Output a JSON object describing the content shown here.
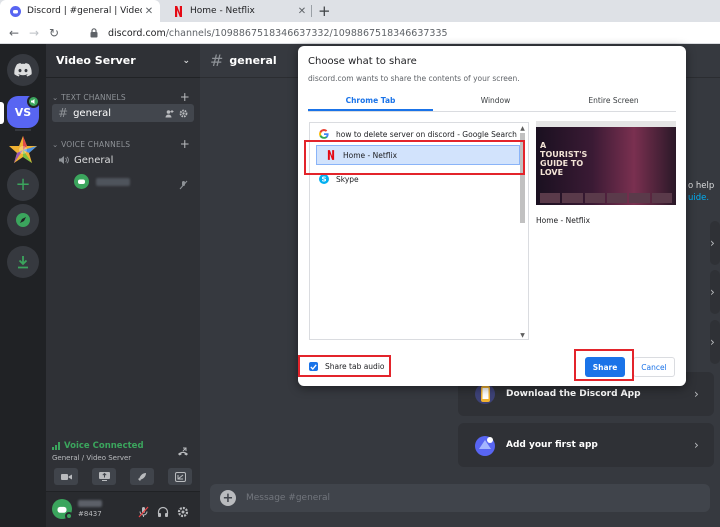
{
  "browser": {
    "tabs": [
      {
        "title": "Discord | #general | Video Server",
        "active": true
      },
      {
        "title": "Home - Netflix",
        "active": false
      }
    ],
    "new_tab": "+",
    "url_host": "discord.com",
    "url_path": "/channels/1098867518346637332/1098867518346637335"
  },
  "guilds": {
    "vs_label": "VS"
  },
  "server": {
    "name": "Video Server",
    "text_category": "TEXT CHANNELS",
    "voice_category": "VOICE CHANNELS",
    "text_channel": "general",
    "voice_channel": "General"
  },
  "voice_status": {
    "title": "Voice Connected",
    "subtitle": "General / Video Server"
  },
  "user": {
    "tag": "#8437"
  },
  "chat": {
    "channel": "general",
    "help_text": "o help",
    "help_link": "uide.",
    "cards": [
      {
        "label": "Download the Discord App"
      },
      {
        "label": "Add your first app"
      }
    ],
    "message_placeholder": "Message #general"
  },
  "share_dialog": {
    "title": "Choose what to share",
    "subtitle": "discord.com wants to share the contents of your screen.",
    "tabs": [
      "Chrome Tab",
      "Window",
      "Entire Screen"
    ],
    "active_tab": "Chrome Tab",
    "sources": [
      {
        "title": "how to delete server on discord - Google Search",
        "icon": "google-icon"
      },
      {
        "title": "Home - Netflix",
        "icon": "netflix-icon",
        "selected": true
      },
      {
        "title": "Skype",
        "icon": "skype-icon"
      }
    ],
    "preview_label": "Home - Netflix",
    "preview_poster": "A TOURIST'S GUIDE TO LOVE",
    "share_audio_label": "Share tab audio",
    "share_audio_checked": true,
    "share_button": "Share",
    "cancel_button": "Cancel"
  },
  "colors": {
    "discord_blurple": "#5865f2",
    "voice_green": "#3ba55d",
    "chrome_blue": "#1a73e8",
    "annotation_red": "#e3242b"
  }
}
